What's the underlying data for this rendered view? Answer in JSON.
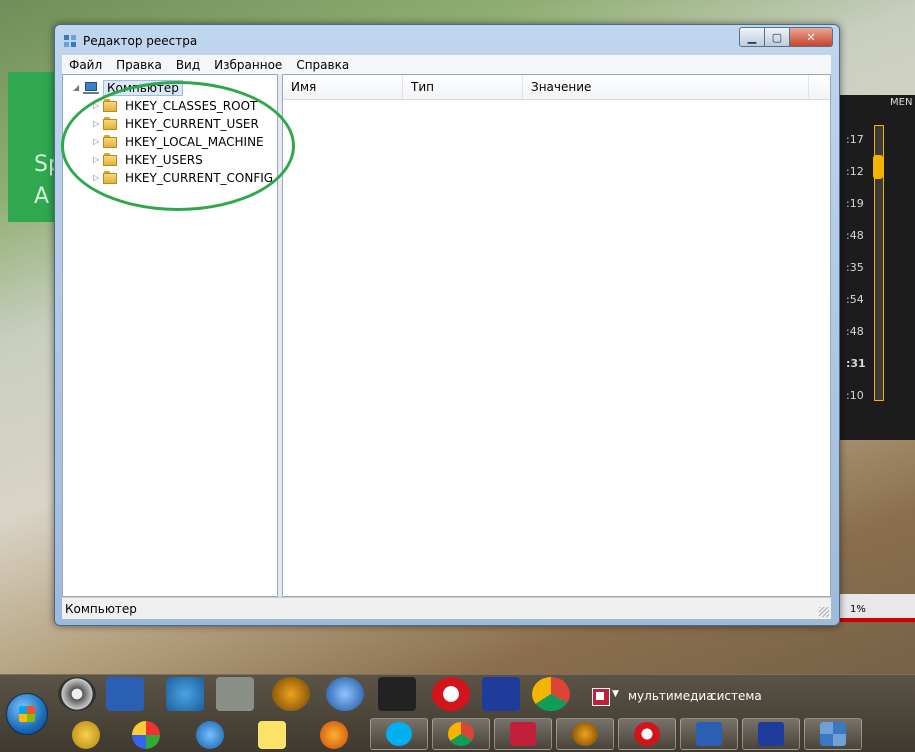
{
  "window": {
    "title": "Редактор реестра",
    "controls": {
      "minimize": "▁",
      "maximize": "▢",
      "close": "✕"
    }
  },
  "menubar": {
    "items": [
      {
        "label": "Файл"
      },
      {
        "label": "Правка"
      },
      {
        "label": "Вид"
      },
      {
        "label": "Избранное"
      },
      {
        "label": "Справка"
      }
    ]
  },
  "tree": {
    "root": {
      "label": "Компьютер",
      "icon": "computer-icon"
    },
    "children": [
      {
        "label": "HKEY_CLASSES_ROOT",
        "icon": "folder-icon"
      },
      {
        "label": "HKEY_CURRENT_USER",
        "icon": "folder-icon"
      },
      {
        "label": "HKEY_LOCAL_MACHINE",
        "icon": "folder-icon"
      },
      {
        "label": "HKEY_USERS",
        "icon": "folder-icon"
      },
      {
        "label": "HKEY_CURRENT_CONFIG",
        "icon": "folder-icon"
      }
    ]
  },
  "list": {
    "columns": [
      {
        "label": "Имя"
      },
      {
        "label": "Тип"
      },
      {
        "label": "Значение"
      }
    ]
  },
  "statusbar": {
    "text": "Компьютер"
  },
  "background": {
    "tile_text": [
      "Sp",
      "A"
    ],
    "player_times": [
      ":17",
      ":12",
      ":19",
      ":48",
      ":35",
      ":54",
      ":48",
      ":31",
      ":10"
    ],
    "menu_label": "MEN",
    "percent": "1%"
  },
  "taskbar": {
    "tray_labels": [
      "мультимедиа",
      "система"
    ]
  },
  "colors": {
    "annotation_ellipse": "#2ea84a",
    "close_button": "#c7442a",
    "accent_green_tile": "#2fa84f"
  }
}
